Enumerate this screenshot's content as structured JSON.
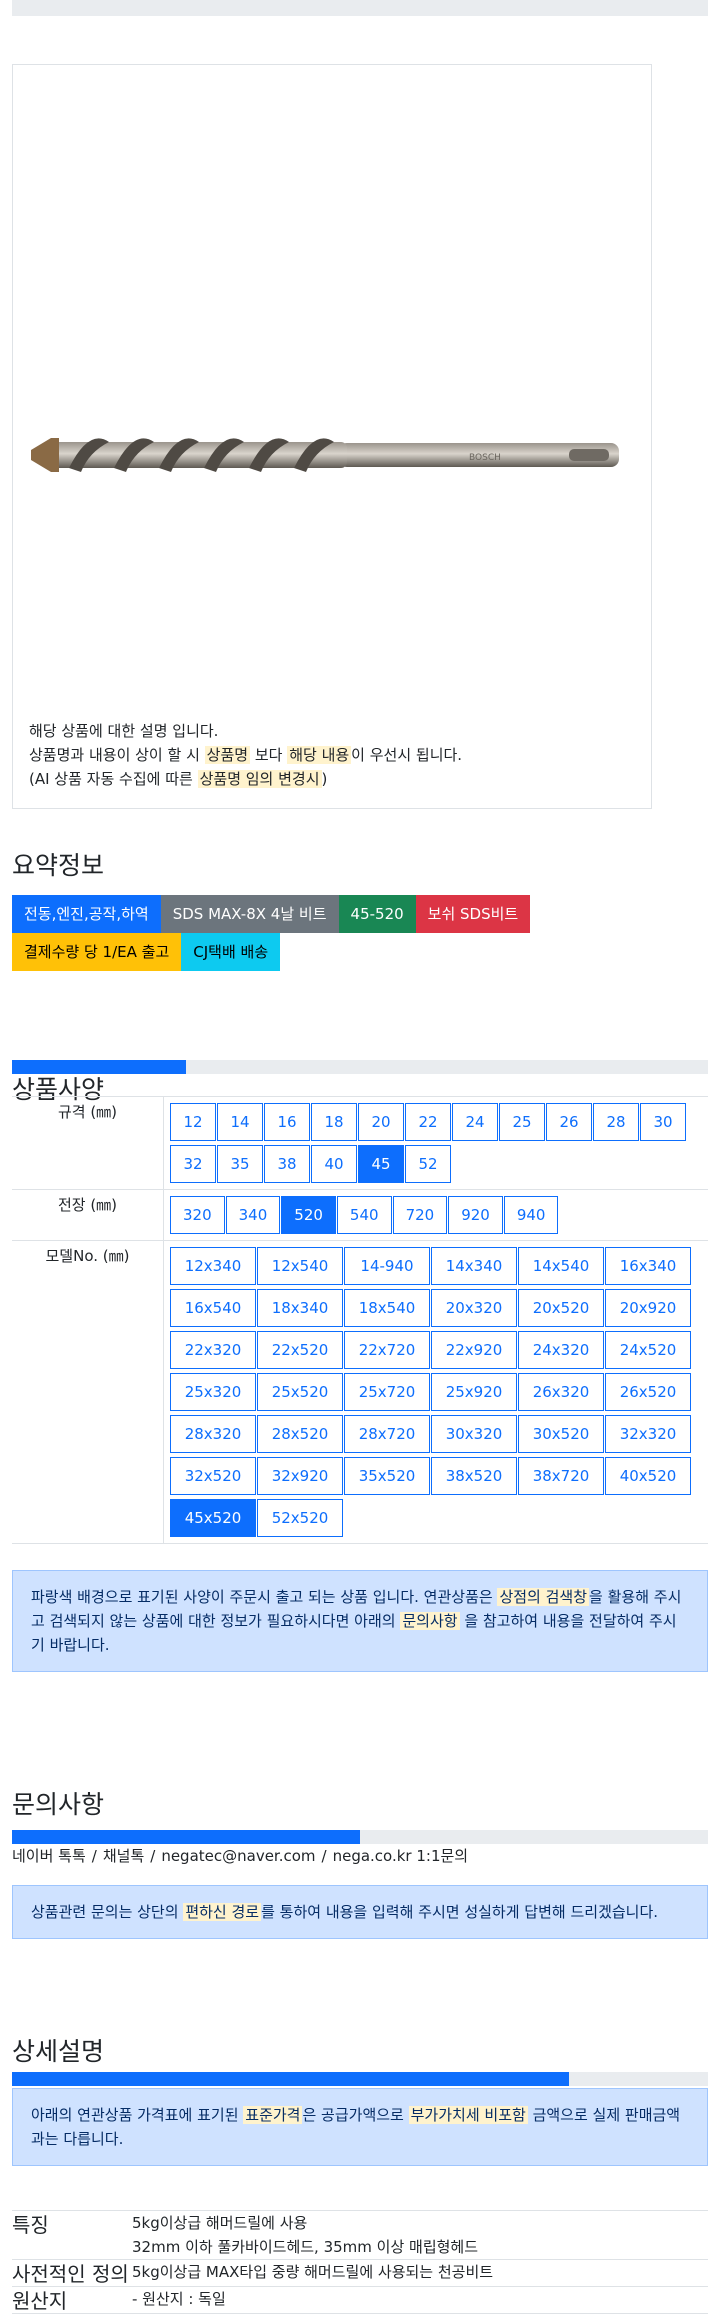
{
  "product_image": {
    "desc_line1": "해당 상품에 대한 설명 입니다.",
    "desc_line2_a": "상품명과 내용이 상이 할 시 ",
    "desc_line2_hl1": "상품명",
    "desc_line2_b": " 보다 ",
    "desc_line2_hl2": "해당 내용",
    "desc_line2_c": "이 우선시 됩니다.",
    "desc_line3_a": "(AI 상품 자동 수집에 따른 ",
    "desc_line3_hl": "상품명 임의 변경시",
    "desc_line3_b": ")"
  },
  "summary": {
    "title": "요약정보",
    "badges": [
      {
        "label": "전동,엔진,공작,하역",
        "color": "#0d6efd"
      },
      {
        "label": "SDS MAX-8X 4날 비트",
        "color": "#6c757d"
      },
      {
        "label": "45-520",
        "color": "#198754"
      },
      {
        "label": "보쉬 SDS비트",
        "color": "#dc3545"
      },
      {
        "label": "결제수량 당 1/EA 출고",
        "color": "#ffc107"
      },
      {
        "label": "CJ택배 배송",
        "color": "#0dcaf0"
      }
    ]
  },
  "spec": {
    "title": "상품사양",
    "progress": 0.25,
    "rows": [
      {
        "label": "규격 (㎜)",
        "options": [
          "12",
          "14",
          "16",
          "18",
          "20",
          "22",
          "24",
          "25",
          "26",
          "28",
          "30",
          "32",
          "35",
          "38",
          "40",
          "45",
          "52"
        ],
        "active": "45"
      },
      {
        "label": "전장 (㎜)",
        "options": [
          "320",
          "340",
          "520",
          "540",
          "720",
          "920",
          "940"
        ],
        "active": "520"
      },
      {
        "label": "모델No. (㎜)",
        "options": [
          "12x340",
          "12x540",
          "14-940",
          "14x340",
          "14x540",
          "16x340",
          "16x540",
          "18x340",
          "18x540",
          "20x320",
          "20x520",
          "20x920",
          "22x320",
          "22x520",
          "22x720",
          "22x920",
          "24x320",
          "24x520",
          "25x320",
          "25x520",
          "25x720",
          "25x920",
          "26x320",
          "26x520",
          "28x320",
          "28x520",
          "28x720",
          "30x320",
          "30x520",
          "32x320",
          "32x520",
          "32x920",
          "35x520",
          "38x520",
          "38x720",
          "40x520",
          "45x520",
          "52x520"
        ],
        "active": "45x520"
      }
    ],
    "notice_a": "파랑색 배경으로 표기된 사양이 주문시 출고 되는 상품 입니다. 연관상품은 ",
    "notice_hl1": "상점의 검색창",
    "notice_b": "을 활용해 주시고 검색되지 않는 상품에 대한 정보가 필요하시다면 아래의 ",
    "notice_hl2": "문의사항",
    "notice_c": " 을 참고하여 내용을 전달하여 주시기 바랍니다."
  },
  "inquiry": {
    "title": "문의사항",
    "progress": 0.5,
    "contacts": [
      "네이버 톡톡",
      "채널톡",
      "negatec@naver.com",
      "nega.co.kr 1:1문의"
    ],
    "separator": "/",
    "notice_a": "상품관련 문의는 상단의 ",
    "notice_hl": "편하신 경로",
    "notice_b": "를 통하여 내용을 입력해 주시면 성실하게 답변해 드리겠습니다."
  },
  "detail": {
    "title": "상세설명",
    "progress": 0.8,
    "notice_a": "아래의 연관상품 가격표에 표기된 ",
    "notice_hl1": "표준가격",
    "notice_b": "은 공급가액으로 ",
    "notice_hl2": "부가가치세 비포함",
    "notice_c": " 금액으로 실제 판매금액과는 다릅니다.",
    "rows": [
      {
        "key": "특징",
        "lines": [
          "5kg이상급 해머드릴에 사용",
          "32mm 이하 풀카바이드헤드, 35mm 이상 매립형헤드"
        ]
      },
      {
        "key": "사전적인 정의",
        "lines": [
          "5kg이상급 MAX타입 중량 해머드릴에 사용되는 천공비트"
        ]
      },
      {
        "key": "원산지",
        "lines": [
          "- 원산지 : 독일"
        ]
      }
    ]
  }
}
